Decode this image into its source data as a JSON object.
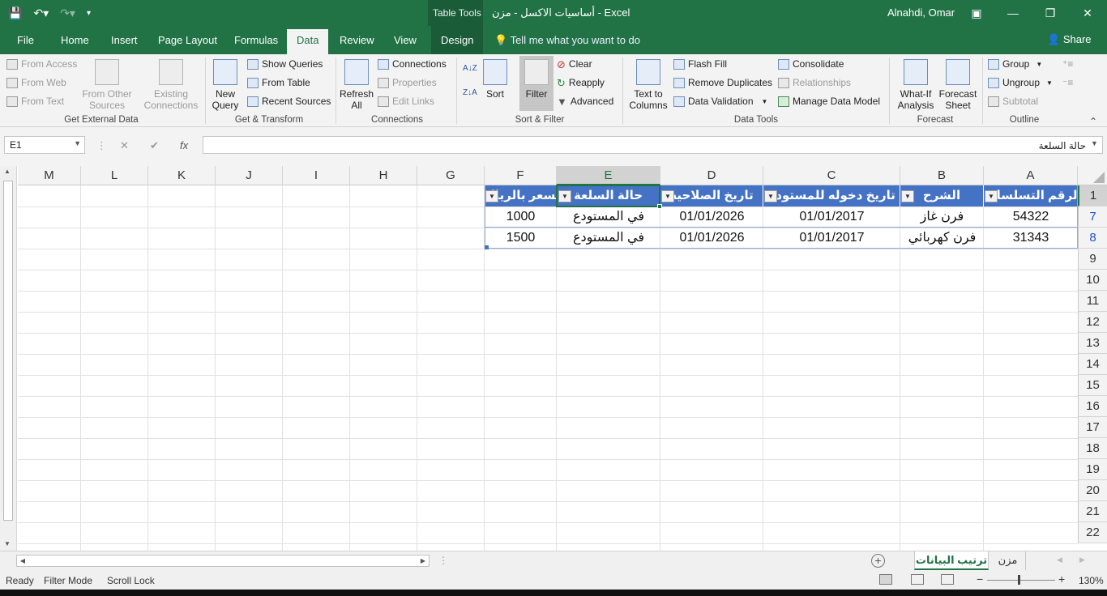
{
  "titlebar": {
    "table_tools": "Table Tools",
    "doc_title": "أساسيات الاكسل - مزن - Excel",
    "user": "Alnahdi, Omar",
    "icons": [
      "save-icon",
      "undo-icon",
      "redo-icon",
      "customize-qat-icon",
      "ribbon-display-icon",
      "minimize-icon",
      "restore-icon",
      "close-icon"
    ]
  },
  "tabs": {
    "file": "File",
    "home": "Home",
    "insert": "Insert",
    "page_layout": "Page Layout",
    "formulas": "Formulas",
    "data": "Data",
    "review": "Review",
    "view": "View",
    "design": "Design",
    "tell_me": "Tell me what you want to do",
    "share": "Share"
  },
  "ribbon": {
    "get_external": {
      "from_access": "From Access",
      "from_web": "From Web",
      "from_text": "From Text",
      "from_other_1": "From Other",
      "from_other_2": "Sources",
      "existing_1": "Existing",
      "existing_2": "Connections",
      "label": "Get External Data"
    },
    "get_transform": {
      "new_query_1": "New",
      "new_query_2": "Query",
      "show_queries": "Show Queries",
      "from_table": "From Table",
      "recent_sources": "Recent Sources",
      "label": "Get & Transform"
    },
    "connections": {
      "refresh_1": "Refresh",
      "refresh_2": "All",
      "connections": "Connections",
      "properties": "Properties",
      "edit_links": "Edit Links",
      "label": "Connections"
    },
    "sort_filter": {
      "sort": "Sort",
      "filter": "Filter",
      "clear": "Clear",
      "reapply": "Reapply",
      "advanced": "Advanced",
      "label": "Sort & Filter"
    },
    "data_tools": {
      "text_to_1": "Text to",
      "text_to_2": "Columns",
      "flash_fill": "Flash Fill",
      "remove_duplicates": "Remove Duplicates",
      "data_validation": "Data Validation",
      "consolidate": "Consolidate",
      "relationships": "Relationships",
      "manage_model": "Manage Data Model",
      "label": "Data Tools"
    },
    "forecast": {
      "what_if_1": "What-If",
      "what_if_2": "Analysis",
      "forecast_1": "Forecast",
      "forecast_2": "Sheet",
      "label": "Forecast"
    },
    "outline": {
      "group": "Group",
      "ungroup": "Ungroup",
      "subtotal": "Subtotal",
      "label": "Outline"
    }
  },
  "formula_bar": {
    "name_box": "E1",
    "cancel": "✕",
    "enter": "✔",
    "fx": "fx",
    "content": "حالة السلعة"
  },
  "grid": {
    "columns": [
      "M",
      "L",
      "K",
      "J",
      "I",
      "H",
      "G",
      "F",
      "E",
      "D",
      "C",
      "B",
      "A"
    ],
    "rows": [
      "1",
      "7",
      "8",
      "9",
      "10",
      "11",
      "12",
      "13",
      "14",
      "15",
      "16",
      "17",
      "18",
      "19",
      "20",
      "21",
      "22"
    ],
    "headers": {
      "A": "الرقم التسلسلي",
      "B": "الشرح",
      "C": "تاريخ دخوله للمستودع",
      "D": "تاريخ الصلاحية",
      "E": "حالة السلعة",
      "F": "السعر بالريال"
    },
    "data_rows": [
      {
        "A": "54322",
        "B": "فرن غاز",
        "C": "01/01/2017",
        "D": "01/01/2026",
        "E": "في المستودع",
        "F": "1000"
      },
      {
        "A": "31343",
        "B": "فرن كهربائي",
        "C": "01/01/2017",
        "D": "01/01/2026",
        "E": "في المستودع",
        "F": "1500"
      }
    ]
  },
  "sheets": {
    "active": "ترتيب البيانات",
    "other": "مزن"
  },
  "status": {
    "ready": "Ready",
    "filter_mode": "Filter Mode",
    "scroll_lock": "Scroll Lock",
    "zoom": "130%"
  },
  "colors": {
    "excel_green": "#217346",
    "table_header": "#4472c4",
    "table_border": "#8eaadb"
  }
}
